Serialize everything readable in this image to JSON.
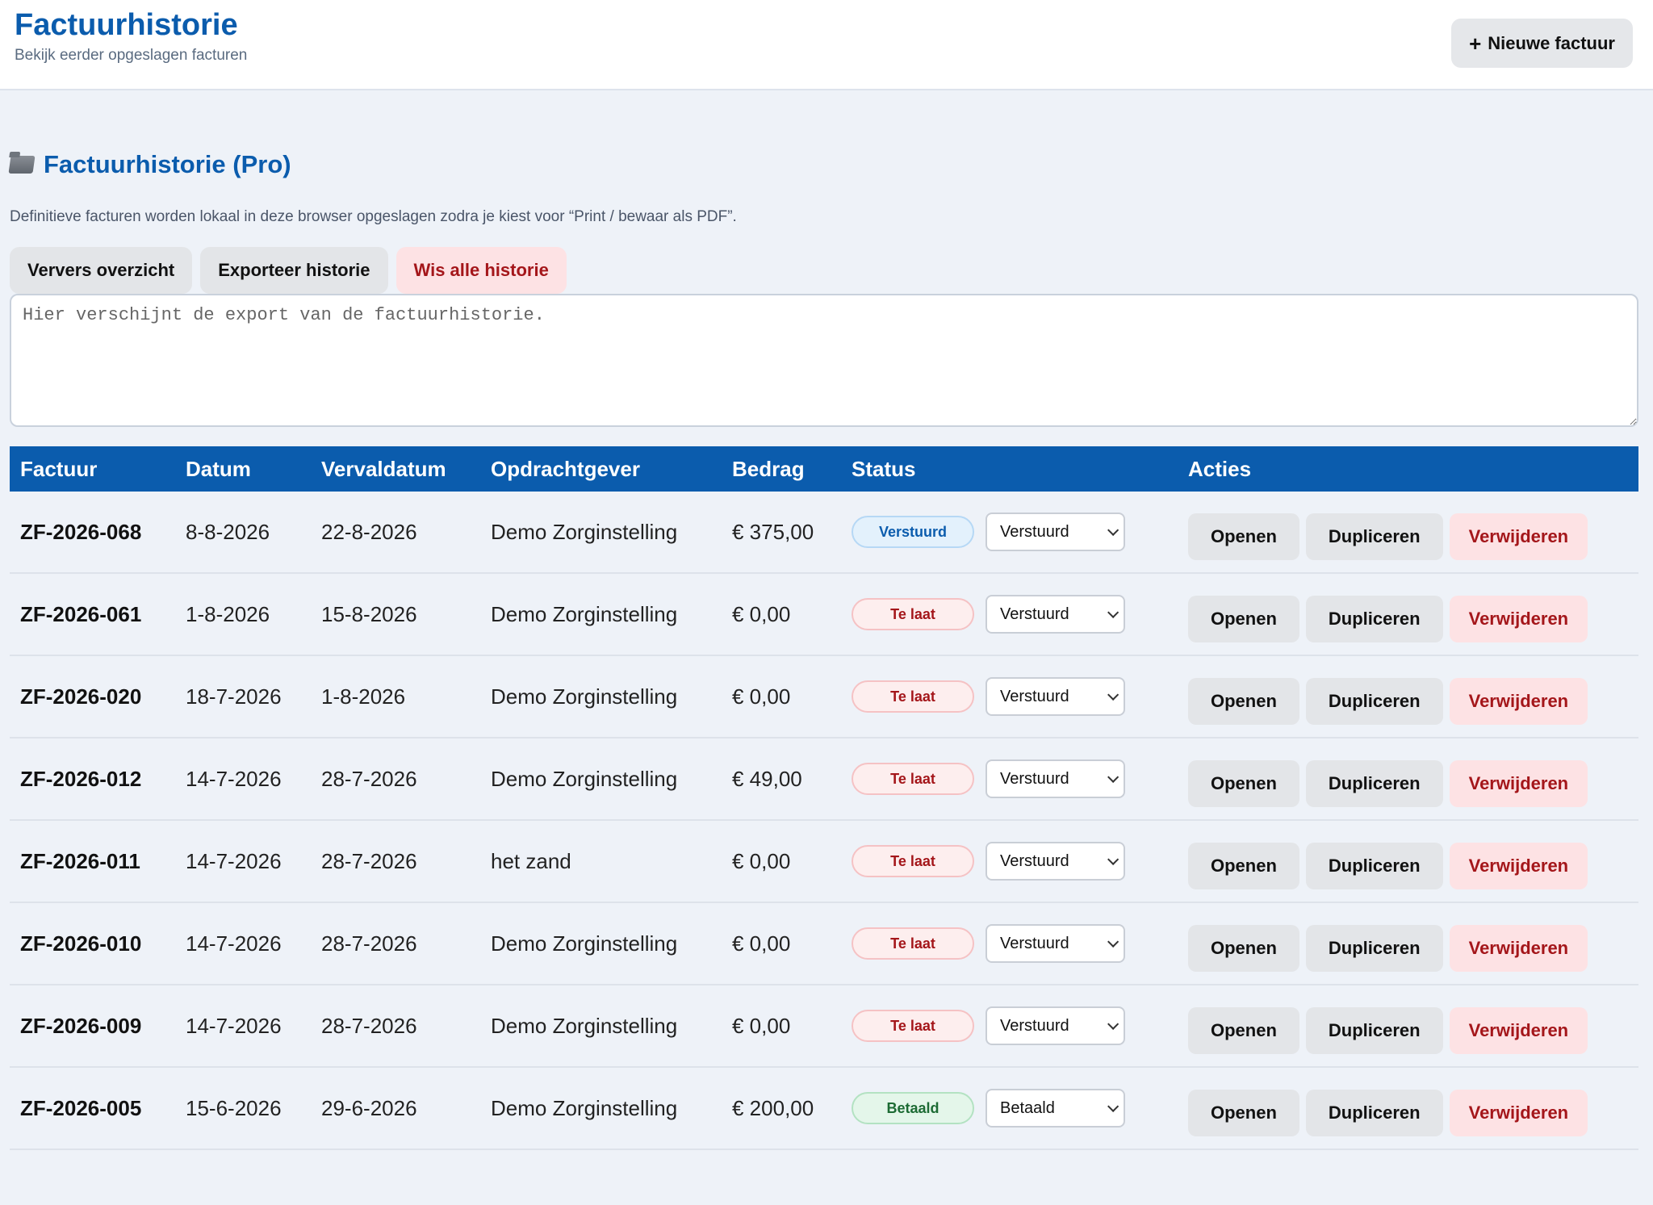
{
  "header": {
    "title": "Factuurhistorie",
    "subtitle": "Bekijk eerder opgeslagen facturen",
    "new_invoice_label": "Nieuwe factuur"
  },
  "section": {
    "title": "Factuurhistorie (Pro)",
    "note": "Definitieve facturen worden lokaal in deze browser opgeslagen zodra je kiest voor “Print / bewaar als PDF”.",
    "refresh_label": "Ververs overzicht",
    "export_label": "Exporteer historie",
    "clear_label": "Wis alle historie",
    "export_placeholder": "Hier verschijnt de export van de factuurhistorie."
  },
  "table": {
    "headers": {
      "invoice": "Factuur",
      "date": "Datum",
      "due": "Vervaldatum",
      "client": "Opdrachtgever",
      "amount": "Bedrag",
      "status": "Status",
      "actions": "Acties"
    },
    "action_labels": {
      "open": "Openen",
      "duplicate": "Dupliceren",
      "delete": "Verwijderen"
    },
    "status_colors": {
      "sent": "#0b5cad",
      "late": "#a4161a",
      "paid": "#1d6b34"
    },
    "rows": [
      {
        "invoice": "ZF-2026-068",
        "date": "8-8-2026",
        "due": "22-8-2026",
        "client": "Demo Zorginstelling",
        "amount": "€ 375,00",
        "badge": "Verstuurd",
        "badge_type": "sent",
        "select": "Verstuurd"
      },
      {
        "invoice": "ZF-2026-061",
        "date": "1-8-2026",
        "due": "15-8-2026",
        "client": "Demo Zorginstelling",
        "amount": "€ 0,00",
        "badge": "Te laat",
        "badge_type": "late",
        "select": "Verstuurd"
      },
      {
        "invoice": "ZF-2026-020",
        "date": "18-7-2026",
        "due": "1-8-2026",
        "client": "Demo Zorginstelling",
        "amount": "€ 0,00",
        "badge": "Te laat",
        "badge_type": "late",
        "select": "Verstuurd"
      },
      {
        "invoice": "ZF-2026-012",
        "date": "14-7-2026",
        "due": "28-7-2026",
        "client": "Demo Zorginstelling",
        "amount": "€ 49,00",
        "badge": "Te laat",
        "badge_type": "late",
        "select": "Verstuurd"
      },
      {
        "invoice": "ZF-2026-011",
        "date": "14-7-2026",
        "due": "28-7-2026",
        "client": "het zand",
        "amount": "€ 0,00",
        "badge": "Te laat",
        "badge_type": "late",
        "select": "Verstuurd"
      },
      {
        "invoice": "ZF-2026-010",
        "date": "14-7-2026",
        "due": "28-7-2026",
        "client": "Demo Zorginstelling",
        "amount": "€ 0,00",
        "badge": "Te laat",
        "badge_type": "late",
        "select": "Verstuurd"
      },
      {
        "invoice": "ZF-2026-009",
        "date": "14-7-2026",
        "due": "28-7-2026",
        "client": "Demo Zorginstelling",
        "amount": "€ 0,00",
        "badge": "Te laat",
        "badge_type": "late",
        "select": "Verstuurd"
      },
      {
        "invoice": "ZF-2026-005",
        "date": "15-6-2026",
        "due": "29-6-2026",
        "client": "Demo Zorginstelling",
        "amount": "€ 200,00",
        "badge": "Betaald",
        "badge_type": "paid",
        "select": "Betaald"
      }
    ]
  }
}
